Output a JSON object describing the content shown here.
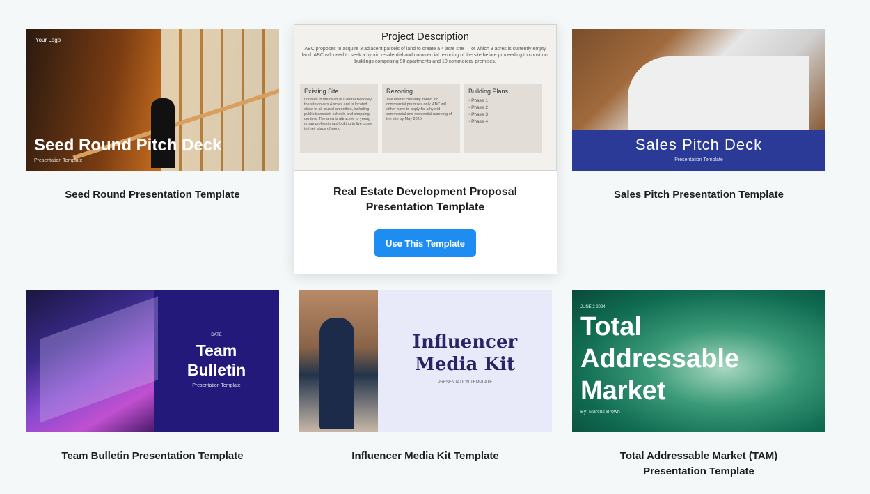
{
  "cards": [
    {
      "title": "Seed Round Presentation Template",
      "thumb": {
        "logo": "Your Logo",
        "heading": "Seed Round Pitch Deck",
        "sub": "Presentation Template"
      }
    },
    {
      "title": "Real Estate Development Proposal Presentation Template",
      "button": "Use This Template",
      "thumb": {
        "heading": "Project Description",
        "desc": "ABC proposes to acquire 3 adjacent parcels of land to create a 4 acre site — of which 3 acres is currently empty land. ABC will need to seek a hybrid residential and commercial rezoning of the site before proceeding to construct buildings comprising 90 apartments and 10 commercial premises.",
        "boxes": [
          {
            "h": "Existing Site",
            "b": "Located in the heart of Central Berkeley the site covers 4 acres and is located close to all crucial amenities, including public transport, schools and shopping centers. The area is attractive to young urban professionals looking to live close to their place of work."
          },
          {
            "h": "Rezoning",
            "b": "The land is currently zoned for commercial premises only. ABC will either have to apply for a hybrid commercial and residential rezoning of the site by May 2025."
          },
          {
            "h": "Building Plans",
            "b": "• Phase 1\n• Phase 2\n• Phase 3\n• Phase 4"
          }
        ]
      }
    },
    {
      "title": "Sales Pitch Presentation Template",
      "thumb": {
        "heading": "Sales Pitch Deck",
        "sub": "Presentation Template"
      }
    },
    {
      "title": "Team Bulletin Presentation Template",
      "thumb": {
        "date": "DATE",
        "heading1": "Team",
        "heading2": "Bulletin",
        "sub": "Presentation Template"
      }
    },
    {
      "title": "Influencer Media Kit Template",
      "thumb": {
        "heading1": "Influencer",
        "heading2": "Media Kit",
        "sub": "PRESENTATION TEMPLATE"
      }
    },
    {
      "title": "Total Addressable Market (TAM) Presentation Template",
      "thumb": {
        "date": "JUNE 2 2024",
        "heading1": "Total",
        "heading2": "Addressable",
        "heading3": "Market",
        "sub": "By: Marcus Brown"
      }
    }
  ],
  "colors": {
    "accent": "#1d8df1",
    "background": "#f4f8f9"
  }
}
